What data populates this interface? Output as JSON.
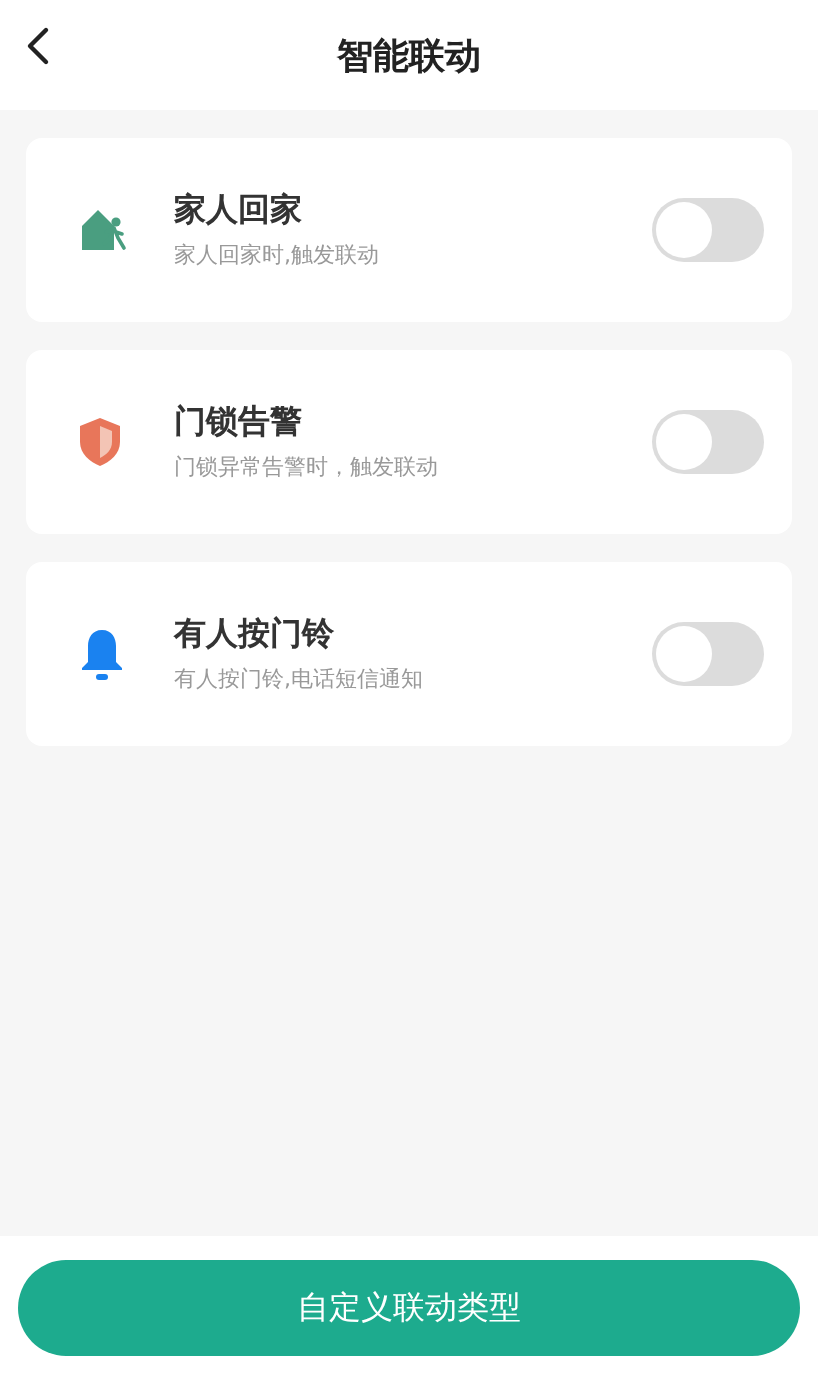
{
  "header": {
    "title": "智能联动"
  },
  "items": [
    {
      "title": "家人回家",
      "description": "家人回家时,触发联动",
      "on": false
    },
    {
      "title": "门锁告警",
      "description": "门锁异常告警时，触发联动",
      "on": false
    },
    {
      "title": "有人按门铃",
      "description": "有人按门铃,电话短信通知",
      "on": false
    }
  ],
  "button": {
    "label": "自定义联动类型"
  }
}
